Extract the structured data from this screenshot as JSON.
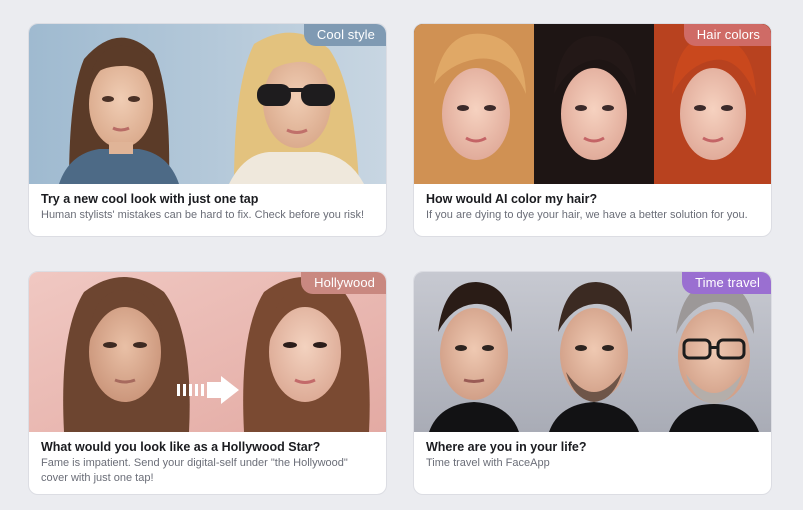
{
  "cards": [
    {
      "badge": "Cool style",
      "badge_color": "#7f9ab3",
      "title": "Try a new cool look with just one tap",
      "subtitle": "Human stylists' mistakes can be hard to fix. Check before you risk!"
    },
    {
      "badge": "Hair colors",
      "badge_color": "#cf6b66",
      "title": "How would AI color my hair?",
      "subtitle": "If you are dying to dye your hair, we have a better solution for you."
    },
    {
      "badge": "Hollywood",
      "badge_color": "#c98880",
      "title": "What would you look like as a Hollywood Star?",
      "subtitle": "Fame is impatient. Send your digital-self under \"the Hollywood\" cover with just one tap!"
    },
    {
      "badge": "Time travel",
      "badge_color": "#9a6fd1",
      "title": "Where are you in your life?",
      "subtitle": "Time travel with FaceApp"
    }
  ]
}
